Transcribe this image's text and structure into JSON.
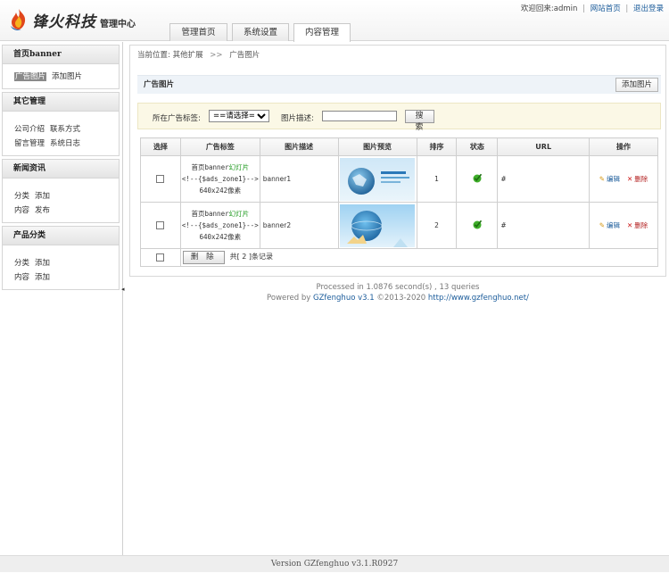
{
  "header": {
    "logo_text": "锋火科技",
    "logo_sub": "管理中心",
    "welcome_prefix": "欢迎回来:",
    "username": "admin",
    "link_home": "网站首页",
    "link_logout": "退出登录"
  },
  "tabs": [
    {
      "label": "管理首页",
      "active": false
    },
    {
      "label": "系统设置",
      "active": false
    },
    {
      "label": "内容管理",
      "active": true
    }
  ],
  "sidebar": {
    "groups": [
      {
        "title": "首页banner",
        "lines": [
          [
            "广告图片",
            "添加图片"
          ]
        ],
        "active_item": "广告图片"
      },
      {
        "title": "其它管理",
        "lines": [
          [
            "公司介绍",
            "联系方式"
          ],
          [
            "留言管理",
            "系统日志"
          ]
        ]
      },
      {
        "title": "新闻资讯",
        "lines": [
          [
            "分类",
            "添加"
          ],
          [
            "内容",
            "发布"
          ]
        ]
      },
      {
        "title": "产品分类",
        "lines": [
          [
            "分类",
            "添加"
          ],
          [
            "内容",
            "添加"
          ]
        ]
      }
    ]
  },
  "breadcrumb": {
    "prefix": "当前位置:",
    "level1": "其他扩展",
    "separator": ">>",
    "level2": "广告图片"
  },
  "panel": {
    "title": "广告图片",
    "add_button": "添加图片"
  },
  "filter": {
    "tag_label": "所在广告标签:",
    "tag_selected": "==请选择==",
    "desc_label": "图片描述:",
    "desc_value": "",
    "search_button": "搜 索"
  },
  "table": {
    "columns": [
      "选择",
      "广告标签",
      "图片描述",
      "图片预览",
      "排序",
      "状态",
      "URL",
      "操作"
    ],
    "rows": [
      {
        "tag_title": "首页banner",
        "tag_type": "幻灯片",
        "tag_code": "<!--{$ads_zone1}-->",
        "tag_size": "640x242像素",
        "desc": "banner1",
        "order": "1",
        "url": "#",
        "edit": "编辑",
        "delete": "删除"
      },
      {
        "tag_title": "首页banner",
        "tag_type": "幻灯片",
        "tag_code": "<!--{$ads_zone1}-->",
        "tag_size": "640x242像素",
        "desc": "banner2",
        "order": "2",
        "url": "#",
        "edit": "编辑",
        "delete": "删除"
      }
    ],
    "delete_button": "删 除",
    "total_text": "共[ 2 ]条记录"
  },
  "stats": {
    "processed": "Processed in 1.0876 second(s) , 13 queries",
    "powered_prefix": "Powered by",
    "product": "GZfenghuo v3.1",
    "copyright": "©2013-2020",
    "site": "http://www.gzfenghuo.net/"
  },
  "footer": {
    "version": "Version GZfenghuo v3.1.R0927"
  },
  "colors": {
    "accent_link": "#1a5b9a",
    "tag_green": "#1f9a1f",
    "delete_red": "#cc1b1b",
    "panel_head_bg": "#eef3f8",
    "filter_bg": "#fbf8e6"
  },
  "icons": [
    "flame-logo-icon",
    "status-ok-icon",
    "edit-pencil-icon",
    "delete-x-icon",
    "collapse-arrow-icon"
  ]
}
